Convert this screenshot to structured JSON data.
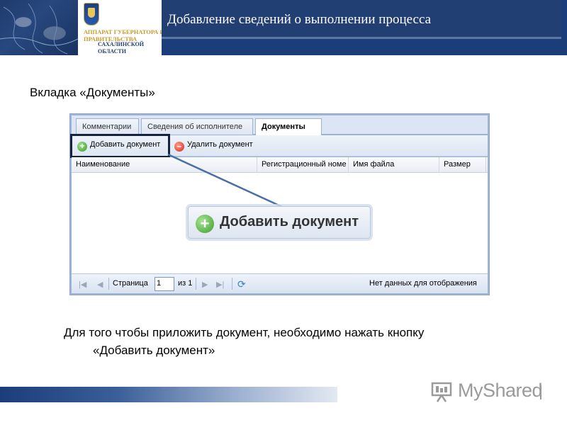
{
  "header": {
    "org_line1": "АППАРАТ ГУБЕРНАТОРА И",
    "org_line2": "ПРАВИТЕЛЬСТВА",
    "org_line3": "САХАЛИНСКОЙ",
    "org_line4": "ОБЛАСТИ",
    "title": "Добавление сведений о выполнении процесса"
  },
  "caption": "Вкладка «Документы»",
  "app": {
    "tabs": [
      {
        "label": "Комментарии"
      },
      {
        "label": "Сведения об исполнителе"
      },
      {
        "label": "Документы"
      }
    ],
    "toolbar": {
      "add_label": "Добавить документ",
      "delete_label": "Удалить документ"
    },
    "columns": [
      {
        "label": "Наименование"
      },
      {
        "label": "Регистрационный номе"
      },
      {
        "label": "Имя файла"
      },
      {
        "label": "Размер"
      }
    ],
    "pager": {
      "page_label": "Страница",
      "page_value": "1",
      "of_label": "из 1",
      "empty_text": "Нет данных для отображения"
    }
  },
  "callout_label": "Добавить документ",
  "instruction_line1": "Для того чтобы приложить документ, необходимо нажать  кнопку",
  "instruction_line2": "«Добавить документ»",
  "watermark": "MyShared",
  "colors": {
    "header_bar": "#223f73",
    "accent": "#1b3d7a",
    "highlight_border": "#16233d"
  }
}
